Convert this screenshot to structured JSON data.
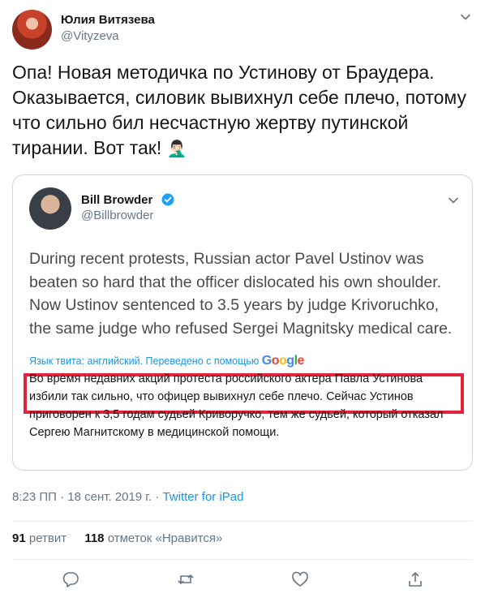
{
  "author": {
    "name": "Юлия Витязева",
    "handle": "@Vityzeva"
  },
  "tweet": {
    "text": "Опа! Новая методичка по Устинову от Браудера. Оказывается, силовик вывихнул себе плечо, потому что сильно бил несчастную жертву путинской тирании. Вот так!",
    "emoji": "🤦🏻‍♂️"
  },
  "quoted": {
    "name": "Bill Browder",
    "handle": "@Billbrowder",
    "text": "During recent protests, Russian actor Pavel Ustinov was beaten so hard that the officer dislocated his own shoulder. Now Ustinov sentenced to 3.5 years by judge Krivoruchko, the same judge who refused Sergei Magnitsky medical care.",
    "translation_label": "Язык твита: английский. Переведено с помощью",
    "translation_brand": "Google",
    "translation": "Во время недавних акций протеста российского актера Павла Устинова избили так сильно, что офицер вывихнул себе плечо. Сейчас Устинов приговорен к 3,5 годам судьей Криворучко, тем же судьей, который отказал Сергею Магнитскому в медицинской помощи."
  },
  "meta": {
    "time": "8:23 ПП · 18 сент. 2019 г. · ",
    "source": "Twitter for iPad"
  },
  "stats": {
    "retweets_count": "91",
    "retweets_label": "ретвит",
    "likes_count": "118",
    "likes_label": "отметок «Нравится»"
  },
  "icons": [
    "chevron-down-icon",
    "verified-icon",
    "reply-icon",
    "retweet-icon",
    "like-icon",
    "share-icon"
  ],
  "colors": {
    "link": "#1b95e0",
    "secondary": "#657786",
    "highlight": "#e3223c",
    "verified": "#1da1f2"
  }
}
